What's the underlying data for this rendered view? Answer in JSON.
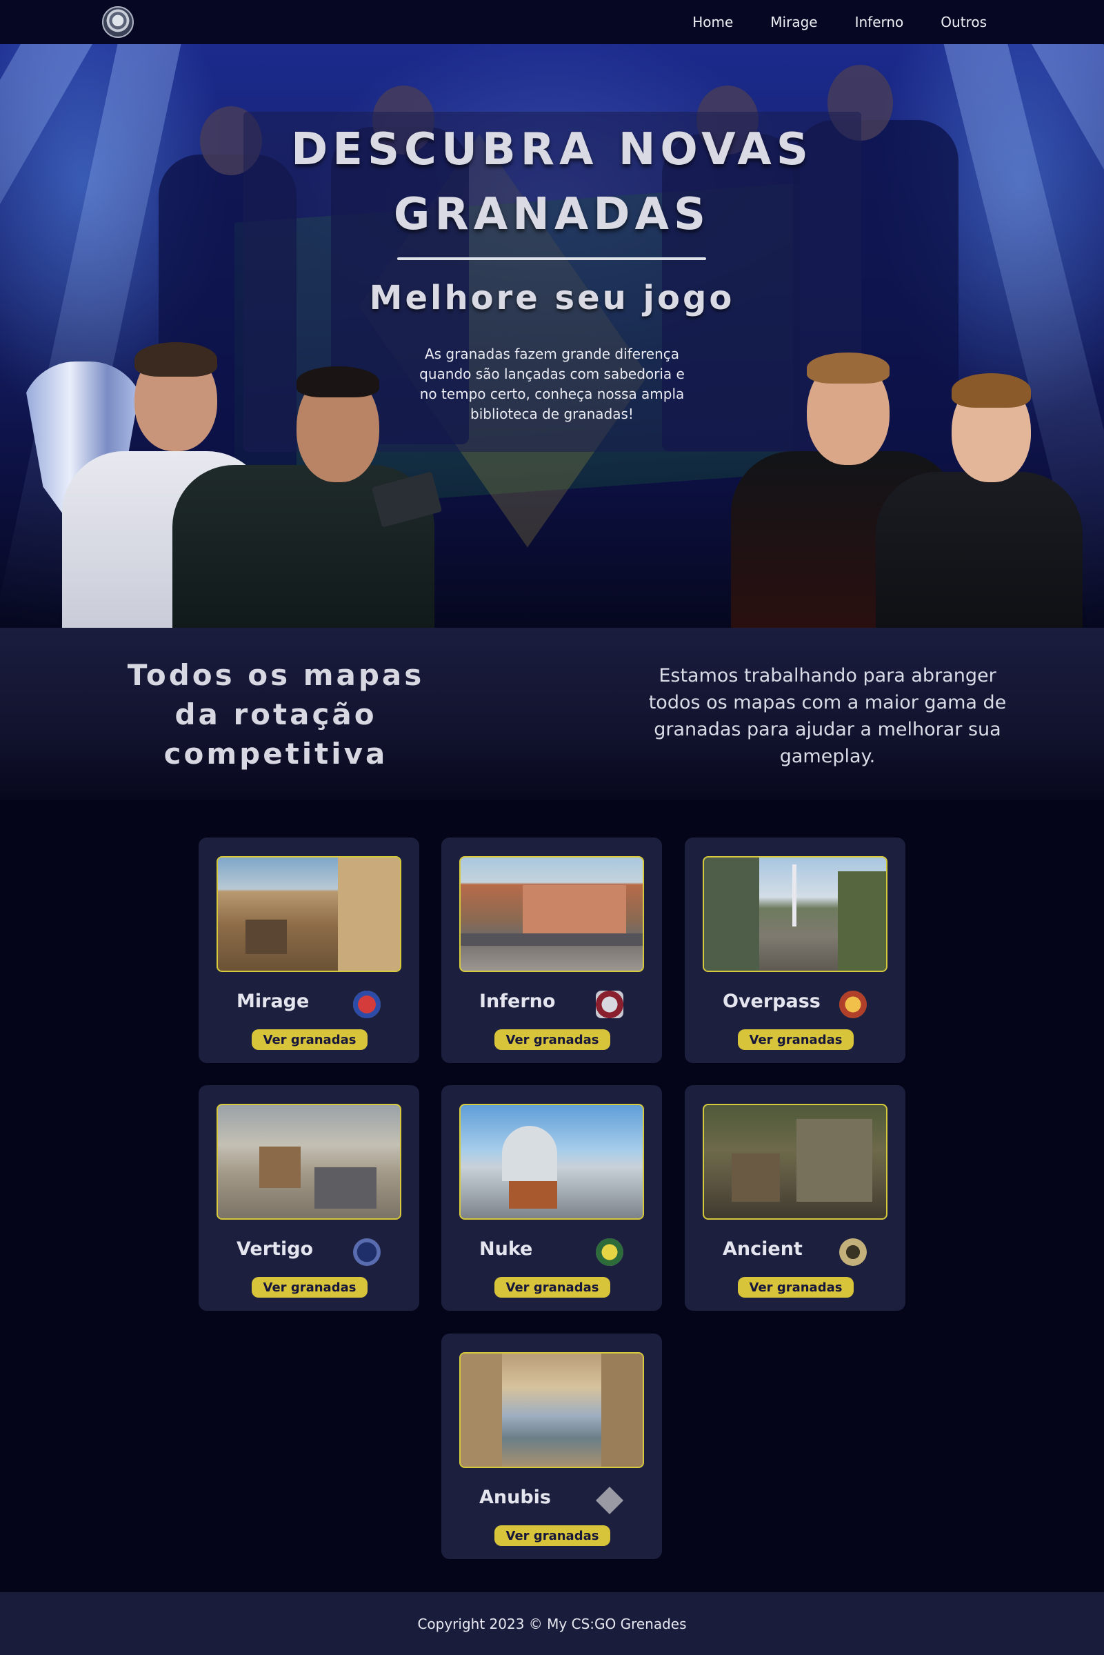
{
  "nav": {
    "logo_icon": "site-logo-emblem",
    "links": [
      "Home",
      "Mirage",
      "Inferno",
      "Outros"
    ]
  },
  "hero": {
    "title": "DESCUBRA NOVAS GRANADAS",
    "subtitle": "Melhore seu jogo",
    "text": "As granadas fazem grande diferença quando são lançadas com sabedoria e no tempo certo, conheça nossa ampla biblioteca de granadas!"
  },
  "intro": {
    "title": "Todos os mapas da rotação competitiva",
    "text": "Estamos trabalhando para abranger todos os mapas com a maior gama de granadas para ajudar a melhorar sua gameplay."
  },
  "maps": [
    {
      "name": "Mirage",
      "button": "Ver granadas",
      "emblem": "mirage-emblem-icon"
    },
    {
      "name": "Inferno",
      "button": "Ver granadas",
      "emblem": "inferno-emblem-icon"
    },
    {
      "name": "Overpass",
      "button": "Ver granadas",
      "emblem": "overpass-emblem-icon"
    },
    {
      "name": "Vertigo",
      "button": "Ver granadas",
      "emblem": "vertigo-emblem-icon"
    },
    {
      "name": "Nuke",
      "button": "Ver granadas",
      "emblem": "nuke-emblem-icon"
    },
    {
      "name": "Ancient",
      "button": "Ver granadas",
      "emblem": "ancient-emblem-icon"
    },
    {
      "name": "Anubis",
      "button": "Ver granadas",
      "emblem": "anubis-emblem-icon"
    }
  ],
  "footer": {
    "copyright": "Copyright 2023 © My CS:GO Grenades"
  },
  "colors": {
    "background": "#05051a",
    "card": "#1c1f3d",
    "accent": "#d8c43a",
    "nav": "#060722"
  }
}
